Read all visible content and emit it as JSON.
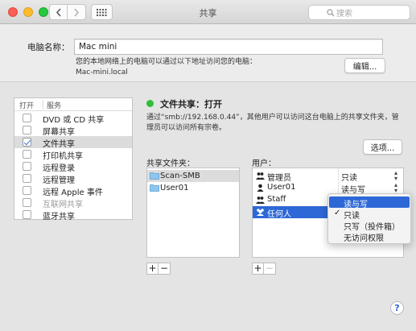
{
  "window": {
    "title": "共享",
    "search_placeholder": "搜索"
  },
  "computer_name": {
    "label": "电脑名称：",
    "value": "Mac mini",
    "desc_line1": "您的本地网络上的电脑可以通过以下地址访问您的电脑：",
    "desc_line2": "Mac-mini.local",
    "edit_button": "编辑..."
  },
  "services": {
    "col_on": "打开",
    "col_service": "服务",
    "items": [
      {
        "label": "DVD 或 CD 共享",
        "checked": false,
        "selected": false,
        "dim": false
      },
      {
        "label": "屏幕共享",
        "checked": false,
        "selected": false,
        "dim": false
      },
      {
        "label": "文件共享",
        "checked": true,
        "selected": true,
        "dim": false
      },
      {
        "label": "打印机共享",
        "checked": false,
        "selected": false,
        "dim": false
      },
      {
        "label": "远程登录",
        "checked": false,
        "selected": false,
        "dim": false
      },
      {
        "label": "远程管理",
        "checked": false,
        "selected": false,
        "dim": false
      },
      {
        "label": "远程 Apple 事件",
        "checked": false,
        "selected": false,
        "dim": false
      },
      {
        "label": "互联网共享",
        "checked": false,
        "selected": false,
        "dim": true
      },
      {
        "label": "蓝牙共享",
        "checked": false,
        "selected": false,
        "dim": false
      }
    ]
  },
  "status": {
    "text": "文件共享：打开",
    "color": "#2fbe3b",
    "desc": "通过“smb://192.168.0.44”，其他用户可以访问这台电脑上的共享文件夹，管理员可以访问所有宗卷。",
    "options_button": "选项..."
  },
  "shared_folders": {
    "label": "共享文件夹：",
    "items": [
      {
        "name": "Scan-SMB",
        "selected": true
      },
      {
        "name": "User01",
        "selected": false
      }
    ],
    "add": "+",
    "remove": "−"
  },
  "users": {
    "label": "用户：",
    "items": [
      {
        "name": "管理员",
        "perm": "只读",
        "selected": false,
        "icon": "group-icon"
      },
      {
        "name": "User01",
        "perm": "读与写",
        "selected": false,
        "icon": "user-icon"
      },
      {
        "name": "Staff",
        "perm": "",
        "selected": false,
        "icon": "group-icon"
      },
      {
        "name": "任何人",
        "perm": "",
        "selected": true,
        "icon": "everyone-icon"
      }
    ],
    "add": "+",
    "remove": "−"
  },
  "permission_menu": {
    "items": [
      {
        "label": "读与写",
        "highlighted": true,
        "checked": false
      },
      {
        "label": "只读",
        "highlighted": false,
        "checked": true
      },
      {
        "label": "只写（投件箱）",
        "highlighted": false,
        "checked": false
      },
      {
        "label": "无访问权限",
        "highlighted": false,
        "checked": false
      }
    ],
    "check_glyph": "✓"
  },
  "help": "?"
}
